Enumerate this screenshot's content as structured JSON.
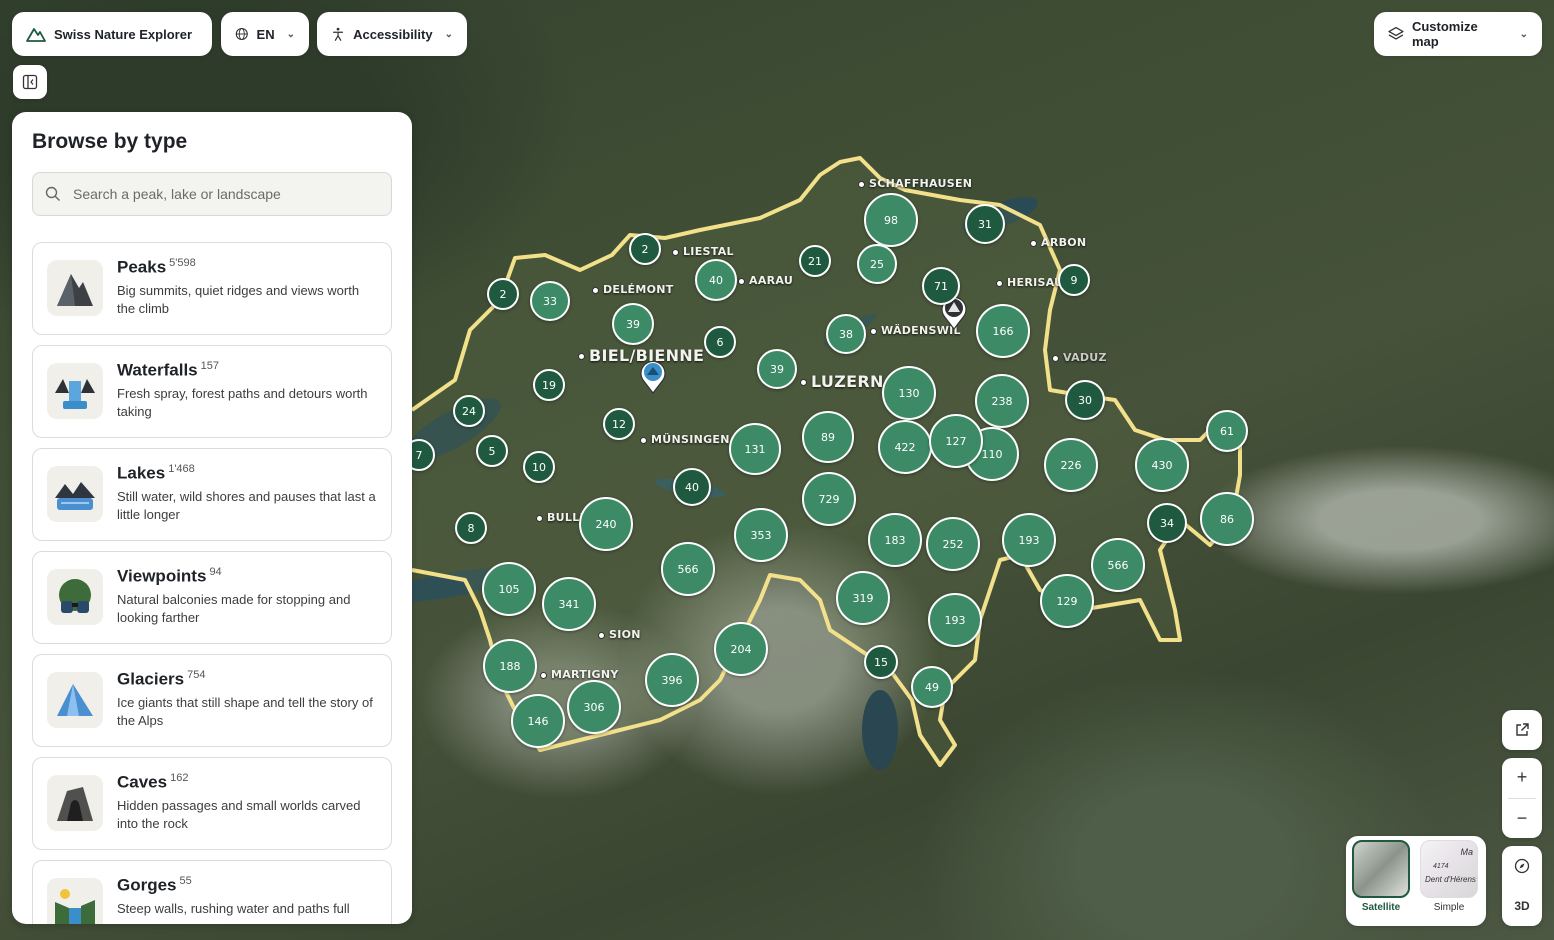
{
  "app": {
    "title": "Swiss Nature Explorer",
    "language": "EN",
    "accessibility_label": "Accessibility",
    "customize_label": "Customize map"
  },
  "panel": {
    "heading": "Browse by type",
    "search_placeholder": "Search a peak, lake or landscape",
    "categories": [
      {
        "title": "Peaks",
        "count": "5'598",
        "desc": "Big summits, quiet ridges and views worth the climb",
        "icon": "peak-icon"
      },
      {
        "title": "Waterfalls",
        "count": "157",
        "desc": "Fresh spray, forest paths and detours worth taking",
        "icon": "waterfall-icon"
      },
      {
        "title": "Lakes",
        "count": "1'468",
        "desc": "Still water, wild shores and pauses that last a little longer",
        "icon": "lake-icon"
      },
      {
        "title": "Viewpoints",
        "count": "94",
        "desc": "Natural balconies made for stopping and looking farther",
        "icon": "binoculars-icon"
      },
      {
        "title": "Glaciers",
        "count": "754",
        "desc": "Ice giants that still shape and tell the story of the Alps",
        "icon": "glacier-icon"
      },
      {
        "title": "Caves",
        "count": "162",
        "desc": "Hidden passages and small worlds carved into the rock",
        "icon": "cave-icon"
      },
      {
        "title": "Gorges",
        "count": "55",
        "desc": "Steep walls, rushing water and paths full",
        "icon": "gorge-icon"
      }
    ]
  },
  "map": {
    "clusters": [
      "2",
      "2",
      "33",
      "39",
      "40",
      "21",
      "98",
      "25",
      "31",
      "71",
      "9",
      "166",
      "38",
      "6",
      "39",
      "19",
      "24",
      "12",
      "5",
      "10",
      "8",
      "7",
      "40",
      "131",
      "89",
      "130",
      "238",
      "30",
      "422",
      "127",
      "110",
      "226",
      "430",
      "61",
      "729",
      "353",
      "240",
      "566",
      "105",
      "341",
      "183",
      "252",
      "193",
      "566",
      "86",
      "34",
      "319",
      "193",
      "129",
      "188",
      "204",
      "396",
      "306",
      "146",
      "15",
      "49"
    ],
    "cities": [
      "SCHAFFHAUSEN",
      "ARBON",
      "LIESTAL",
      "DELÉMONT",
      "AARAU",
      "HERISAU",
      "WÄDENSWIL",
      "BIEL/BIENNE",
      "LUZERN",
      "VADUZ",
      "MÜNSINGEN",
      "BULLE",
      "SION",
      "MARTIGNY"
    ]
  },
  "controls": {
    "zoom_in": "+",
    "zoom_out": "−",
    "mode_3d": "3D",
    "basemaps": [
      {
        "label": "Satellite",
        "selected": true
      },
      {
        "label": "Simple",
        "selected": false
      }
    ],
    "simple_thumb_texts": [
      "Ma",
      "4174",
      "Dent d'Hérens"
    ]
  },
  "colors": {
    "cluster": "#3c8a66",
    "border": "#f2e08a",
    "accent": "#1f5a40"
  }
}
